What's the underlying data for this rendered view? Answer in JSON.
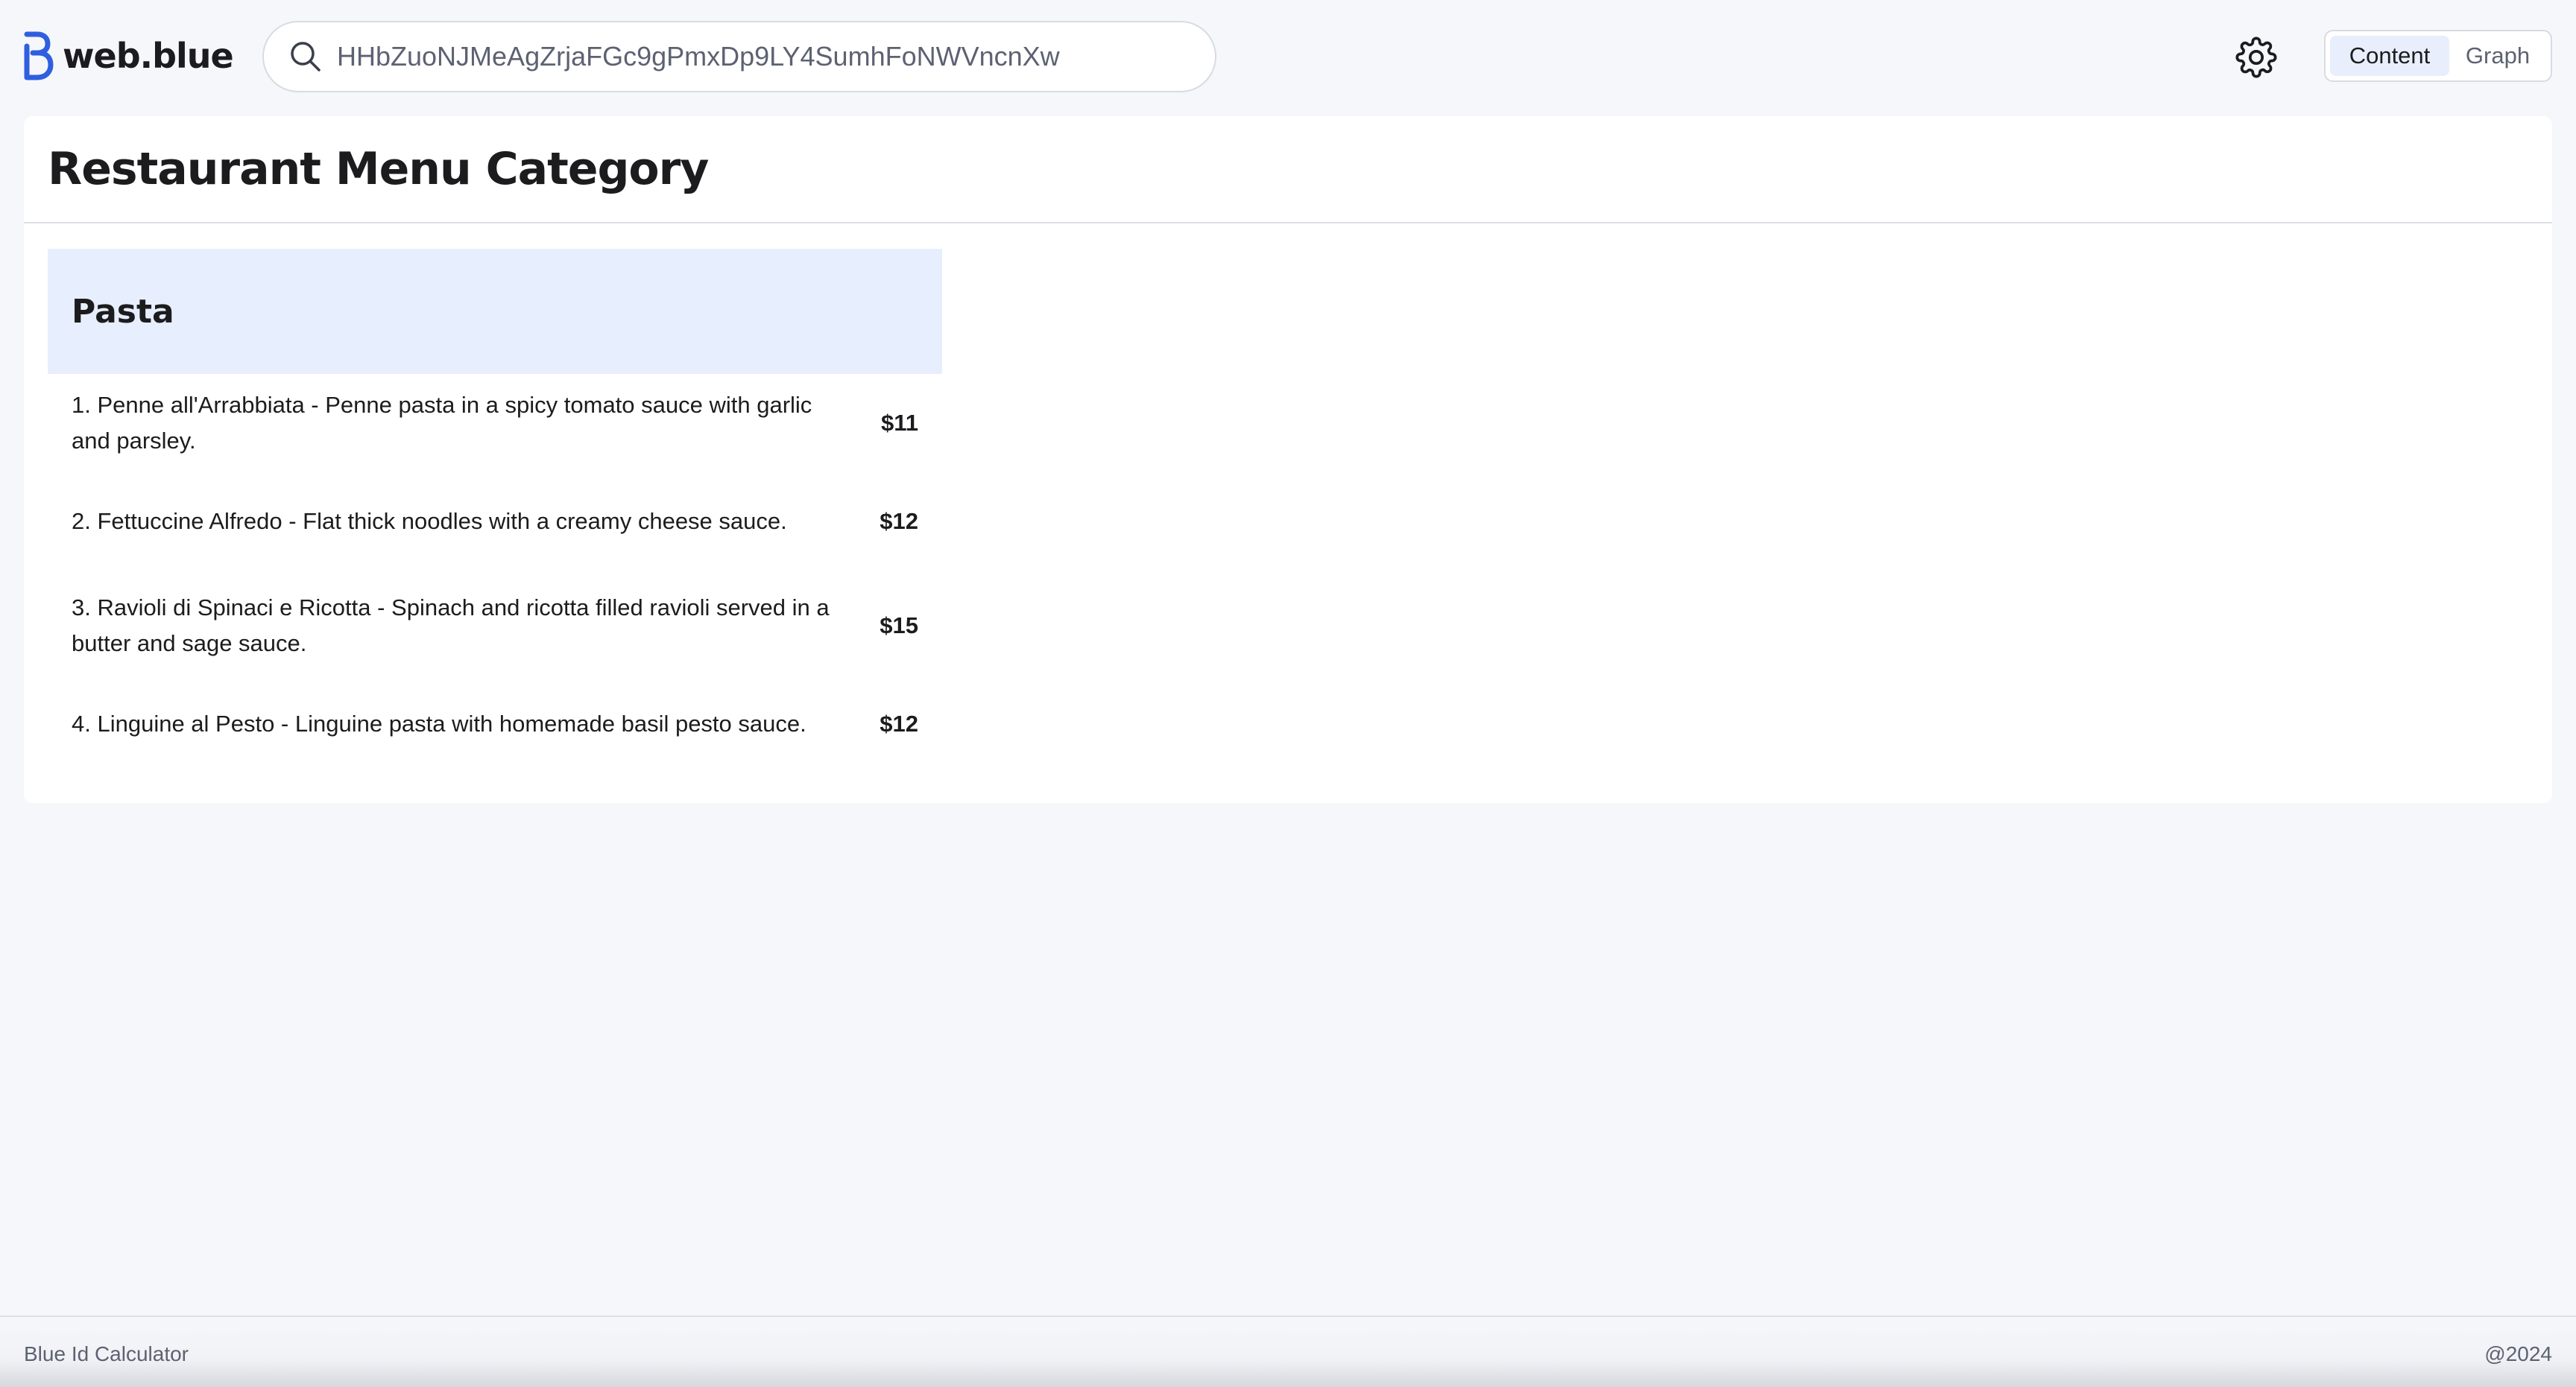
{
  "header": {
    "logo_text": "web.blue",
    "search": {
      "value": "HHbZuoNJMeAgZrjaFGc9gPmxDp9LY4SumhFoNWVncnXw"
    },
    "view_toggle": {
      "content_label": "Content",
      "graph_label": "Graph",
      "active": "Content"
    },
    "settings_icon": "gear-icon"
  },
  "main": {
    "title": "Restaurant Menu Category",
    "category": {
      "name": "Pasta",
      "items": [
        {
          "description": "1. Penne all'Arrabbiata - Penne pasta in a spicy tomato sauce with garlic and parsley.",
          "price": "$11"
        },
        {
          "description": "2. Fettuccine Alfredo - Flat thick noodles with a creamy cheese sauce.",
          "price": "$12"
        },
        {
          "description": "3. Ravioli di Spinaci e Ricotta - Spinach and ricotta filled ravioli served in a butter and sage sauce.",
          "price": "$15"
        },
        {
          "description": "4. Linguine al Pesto - Linguine pasta with homemade basil pesto sauce.",
          "price": "$12"
        }
      ]
    }
  },
  "footer": {
    "left_text": "Blue Id Calculator",
    "right_text": "@2024"
  },
  "colors": {
    "brand_blue": "#2f5fe0",
    "category_header_bg": "#e7eefd",
    "page_bg": "#f6f7fb",
    "toggle_active_bg": "#e8eefc"
  }
}
